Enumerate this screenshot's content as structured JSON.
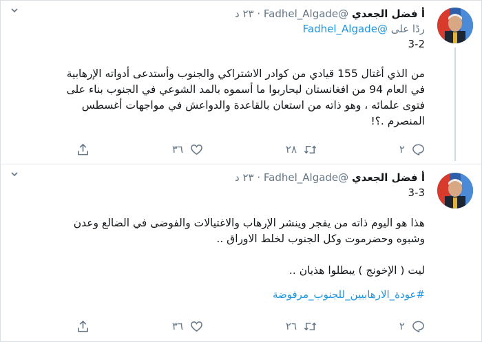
{
  "tweets": [
    {
      "name": "أ فضل الجعدي",
      "handle": "@Fadhel_Algade",
      "time": "· ٢٣ د",
      "reply_prefix": "ردًا على",
      "reply_handle": "@Fadhel_Algade",
      "number": "3-2",
      "text_lines": [
        "من الذي أغتال 155 قيادي من كوادر الاشتراكي والجنوب وأستدعى أدواته الإرهابية",
        "في العام 94 من افغانستان ليحاربوا ما أسموه بالمد الشوعي في الجنوب بناء على",
        "فتوى علمائه ، وهو ذاته من استعان بالقاعدة والدواعش في مواجهات أغسطس",
        "المنصرم .؟!"
      ],
      "actions": {
        "reply_count": "٢",
        "retweet_count": "٢٨",
        "like_count": "٣٦"
      }
    },
    {
      "name": "أ فضل الجعدي",
      "handle": "@Fadhel_Algade",
      "time": "· ٢٣ د",
      "number": "3-3",
      "text_lines": [
        "هذا هو اليوم ذاته من يفجر وينشر الإرهاب والاغتيالات والفوضى في الضالع وعدن",
        "وشبوه وحضرموت وكل الجنوب لخلط الاوراق ..",
        "",
        "ليت ( الإخونج ) يبطلوا هذيان .."
      ],
      "hashtag": "#عودة_الارهابيين_للجنوب_مرفوضة",
      "actions": {
        "reply_count": "٢",
        "retweet_count": "٢٦",
        "like_count": "٣٦"
      }
    }
  ],
  "icons": {
    "reply": "reply-icon",
    "retweet": "retweet-icon",
    "like": "heart-icon",
    "share": "share-icon",
    "more": "chevron-down-icon"
  },
  "colors": {
    "link": "#1b95e0",
    "muted": "#657786",
    "text": "#14171a",
    "thread_line": "#cfd9de"
  }
}
